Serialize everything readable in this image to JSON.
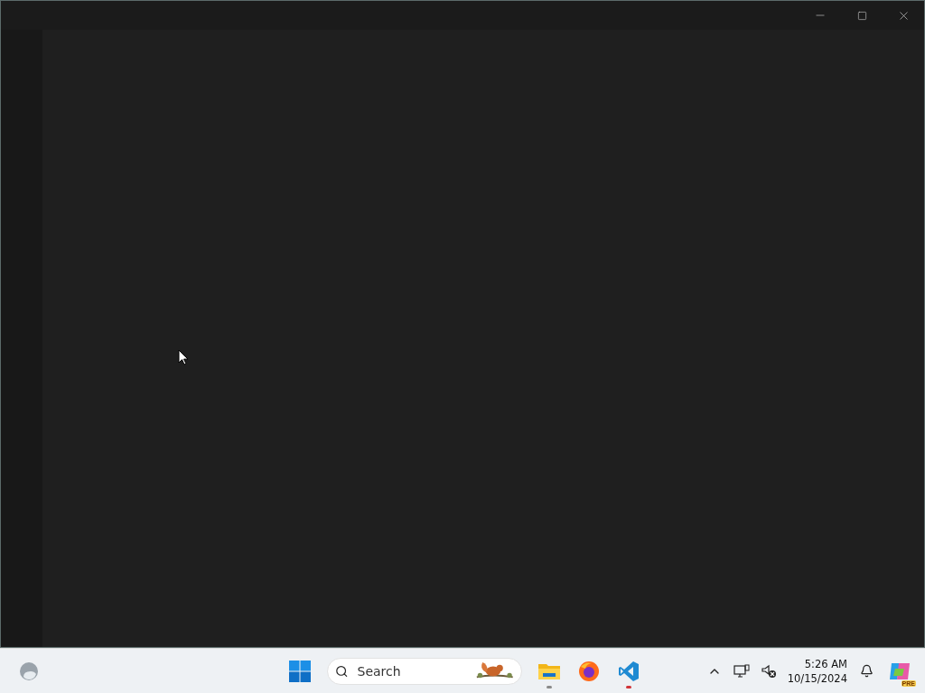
{
  "window": {
    "controls": [
      {
        "kind": "minimize"
      },
      {
        "kind": "maximize"
      },
      {
        "kind": "close"
      }
    ]
  },
  "taskbar": {
    "widget": {
      "kind": "weather"
    },
    "search": {
      "placeholder": "Search"
    },
    "apps": [
      {
        "kind": "explorer",
        "running": true,
        "color": "#8a8a8a"
      },
      {
        "kind": "firefox",
        "running": false
      },
      {
        "kind": "vscode",
        "running": true,
        "color": "#d13438"
      }
    ],
    "tray": [
      {
        "kind": "chevron"
      },
      {
        "kind": "network"
      },
      {
        "kind": "sound"
      }
    ],
    "clock": {
      "time": "5:26 AM",
      "date": "10/15/2024"
    },
    "copilot": {
      "badge": "PRE"
    }
  }
}
